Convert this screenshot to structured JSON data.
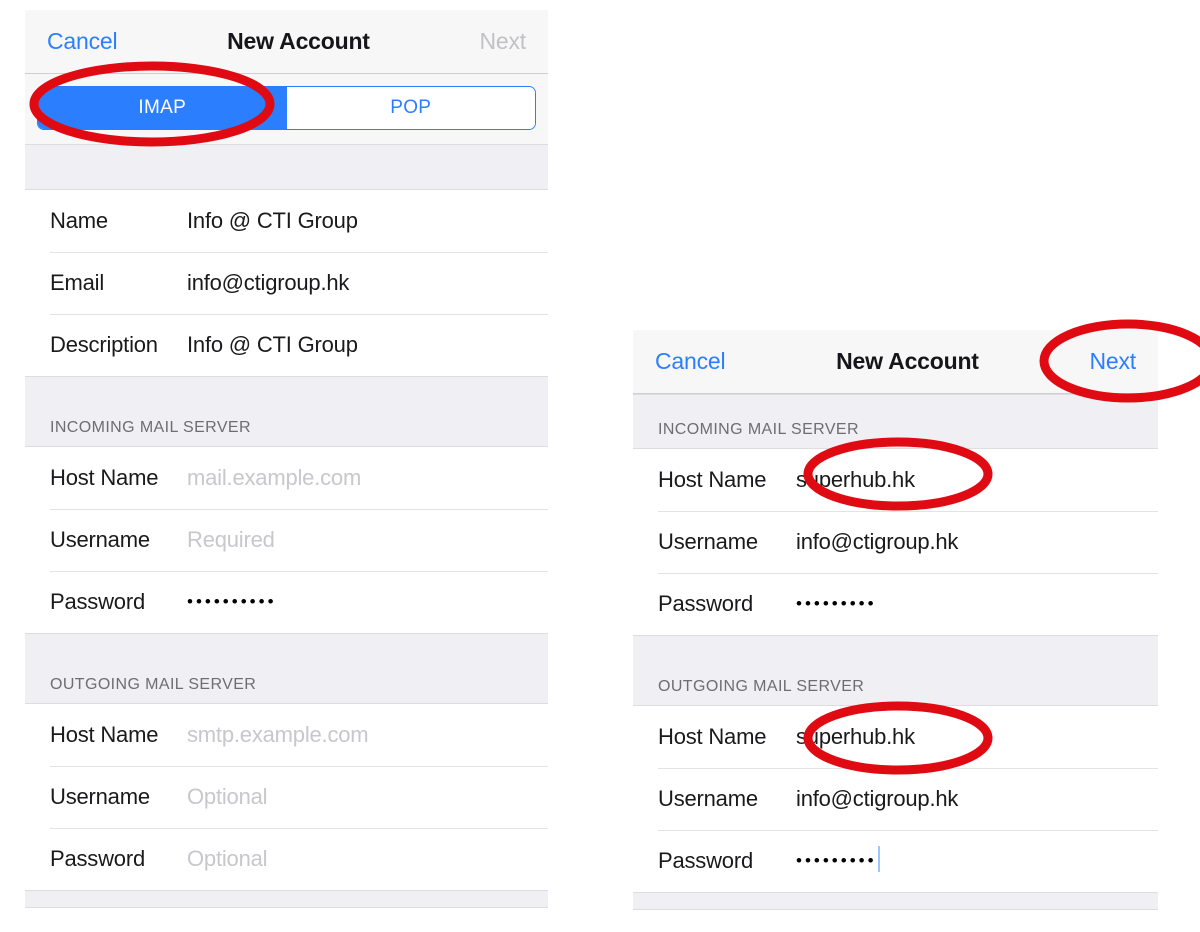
{
  "left_panel": {
    "navbar": {
      "cancel_label": "Cancel",
      "title": "New Account",
      "next_label": "Next",
      "next_state": "disabled"
    },
    "segmented_control": {
      "options": [
        "IMAP",
        "POP"
      ],
      "selected": "IMAP"
    },
    "account_section": {
      "rows": [
        {
          "label": "Name",
          "value": "Info @ CTI Group",
          "is_placeholder": false
        },
        {
          "label": "Email",
          "value": "info@ctigroup.hk",
          "is_placeholder": false
        },
        {
          "label": "Description",
          "value": "Info @ CTI Group",
          "is_placeholder": false
        }
      ]
    },
    "incoming_section": {
      "header": "INCOMING MAIL SERVER",
      "rows": [
        {
          "label": "Host Name",
          "value": "mail.example.com",
          "is_placeholder": true
        },
        {
          "label": "Username",
          "value": "Required",
          "is_placeholder": true
        },
        {
          "label": "Password",
          "value": "••••••••••",
          "is_placeholder": false,
          "masked": true
        }
      ]
    },
    "outgoing_section": {
      "header": "OUTGOING MAIL SERVER",
      "rows": [
        {
          "label": "Host Name",
          "value": "smtp.example.com",
          "is_placeholder": true
        },
        {
          "label": "Username",
          "value": "Optional",
          "is_placeholder": true
        },
        {
          "label": "Password",
          "value": "Optional",
          "is_placeholder": true
        }
      ]
    }
  },
  "right_panel": {
    "navbar": {
      "cancel_label": "Cancel",
      "title": "New Account",
      "next_label": "Next",
      "next_state": "enabled"
    },
    "incoming_section": {
      "header": "INCOMING MAIL SERVER",
      "rows": [
        {
          "label": "Host Name",
          "value": "superhub.hk",
          "is_placeholder": false
        },
        {
          "label": "Username",
          "value": "info@ctigroup.hk",
          "is_placeholder": false
        },
        {
          "label": "Password",
          "value": "•••••••••",
          "is_placeholder": false,
          "masked": true
        }
      ]
    },
    "outgoing_section": {
      "header": "OUTGOING MAIL SERVER",
      "rows": [
        {
          "label": "Host Name",
          "value": "superhub.hk",
          "is_placeholder": false
        },
        {
          "label": "Username",
          "value": "info@ctigroup.hk",
          "is_placeholder": false
        },
        {
          "label": "Password",
          "value": "•••••••••",
          "is_placeholder": false,
          "masked": true,
          "caret": true
        }
      ]
    }
  },
  "annotations": {
    "color": "#e00b12",
    "marks": [
      {
        "target": "imap-segment",
        "shape": "ellipse"
      },
      {
        "target": "right-next-button",
        "shape": "ellipse"
      },
      {
        "target": "right-incoming-host-name",
        "shape": "ellipse"
      },
      {
        "target": "right-outgoing-host-name",
        "shape": "ellipse"
      }
    ]
  },
  "colors": {
    "accent_blue": "#2b7fff",
    "annotation_red": "#e00b12",
    "group_background": "#efeff4",
    "placeholder_gray": "#c7c7cc"
  }
}
